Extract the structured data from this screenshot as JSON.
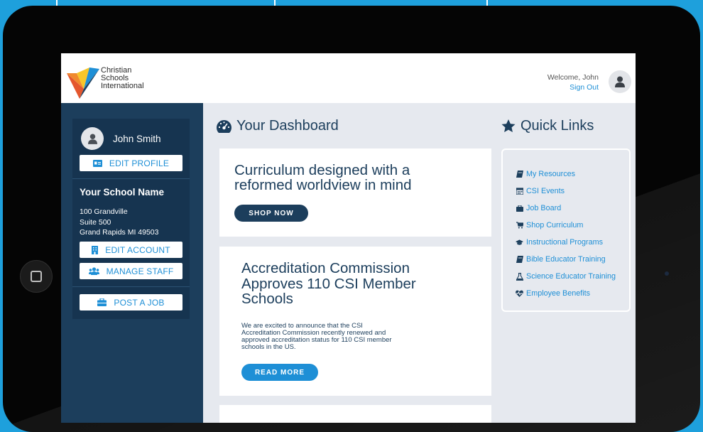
{
  "header": {
    "logo_lines": [
      "Christian",
      "Schools",
      "International"
    ],
    "welcome": "Welcome, John",
    "sign_out": "Sign Out"
  },
  "sidebar": {
    "user_name": "John Smith",
    "edit_profile": "EDIT PROFILE",
    "school_name": "Your School Name",
    "address": [
      "100 Grandville",
      "Suite 500",
      "Grand Rapids MI 49503"
    ],
    "edit_account": "EDIT ACCOUNT",
    "manage_staff": "MANAGE STAFF",
    "post_job": "POST A JOB"
  },
  "dashboard": {
    "title": "Your Dashboard",
    "promo_heading": "Curriculum designed with a reformed worldview in mind",
    "promo_button": "SHOP NOW",
    "news_heading": "Accreditation Commission Approves 110 CSI Member Schools",
    "news_body": "We are excited to announce that the CSI Accreditation Commission recently renewed and approved accreditation status for 110 CSI member schools in the US.",
    "news_button": "READ MORE"
  },
  "quick_links": {
    "title": "Quick Links",
    "items": [
      {
        "label": "My Resources",
        "icon": "book-icon"
      },
      {
        "label": "CSI Events",
        "icon": "calendar-icon"
      },
      {
        "label": "Job Board",
        "icon": "briefcase-icon"
      },
      {
        "label": "Shop Curriculum",
        "icon": "cart-icon"
      },
      {
        "label": "Instructional Programs",
        "icon": "graduation-cap-icon"
      },
      {
        "label": "Bible Educator Training",
        "icon": "book-icon"
      },
      {
        "label": "Science Educator Training",
        "icon": "flask-icon"
      },
      {
        "label": "Employee Benefits",
        "icon": "heartbeat-icon"
      }
    ]
  },
  "colors": {
    "navy": "#1c3e5c",
    "accent_blue": "#1e8fd6",
    "background": "#1ea0dc"
  }
}
